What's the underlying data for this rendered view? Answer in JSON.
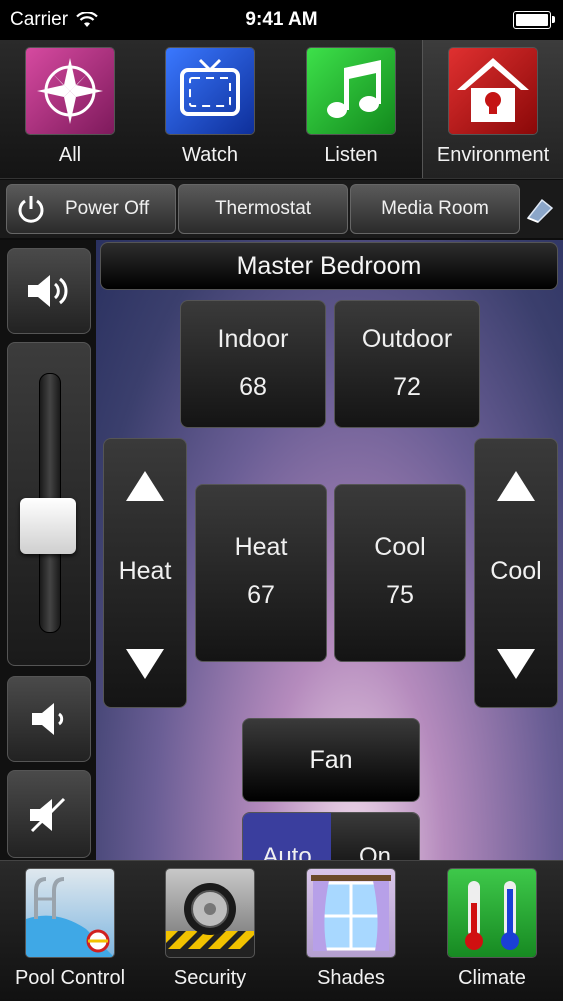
{
  "status": {
    "carrier": "Carrier",
    "time": "9:41 AM"
  },
  "top_nav": [
    {
      "label": "All",
      "icon": "compass-icon",
      "color": "#b0307e"
    },
    {
      "label": "Watch",
      "icon": "tv-icon",
      "color": "#1f4fd6"
    },
    {
      "label": "Listen",
      "icon": "music-note-icon",
      "color": "#27b534"
    },
    {
      "label": "Environment",
      "icon": "house-bulb-icon",
      "color": "#c41414"
    }
  ],
  "active_nav": "Environment",
  "scene_bar": {
    "power_label": "Power Off",
    "thermostat_label": "Thermostat",
    "room_label": "Media Room"
  },
  "room_title": "Master Bedroom",
  "indoor": {
    "label": "Indoor",
    "value": "68"
  },
  "outdoor": {
    "label": "Outdoor",
    "value": "72"
  },
  "heat_set": {
    "label": "Heat",
    "value": "67"
  },
  "cool_set": {
    "label": "Cool",
    "value": "75"
  },
  "heat_adjust_label": "Heat",
  "cool_adjust_label": "Cool",
  "fan": {
    "label": "Fan",
    "auto_label": "Auto",
    "on_label": "On",
    "active_mode": "Auto"
  },
  "volume_level": 0.4,
  "bottom_nav": [
    {
      "label": "Pool Control",
      "icon": "pool-icon"
    },
    {
      "label": "Security",
      "icon": "safe-dial-icon"
    },
    {
      "label": "Shades",
      "icon": "window-shades-icon"
    },
    {
      "label": "Climate",
      "icon": "thermometer-icon"
    }
  ]
}
